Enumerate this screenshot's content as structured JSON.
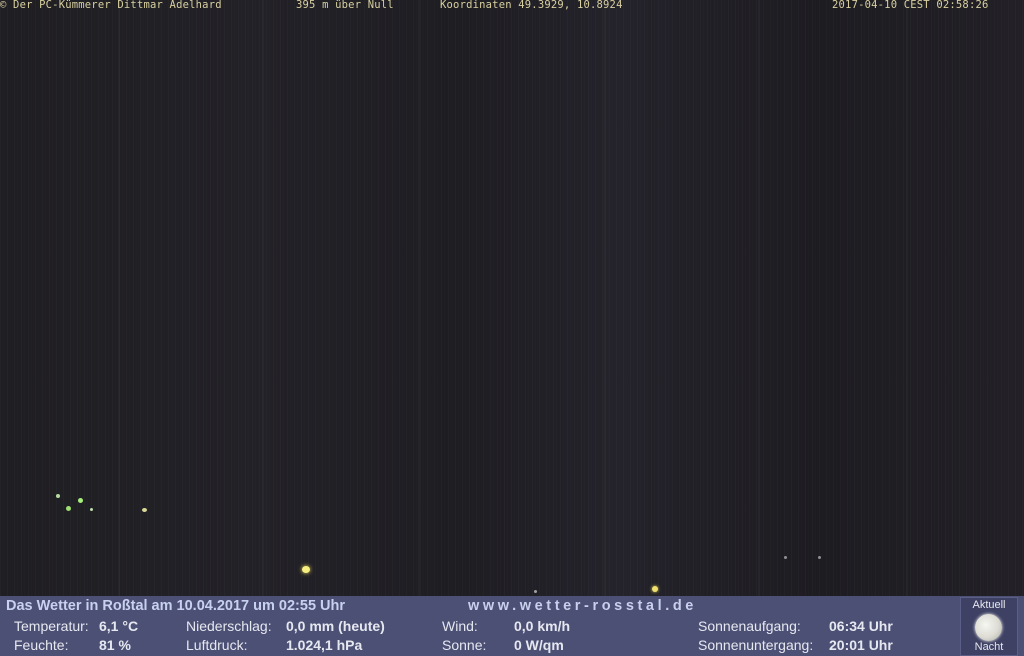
{
  "overlay": {
    "copyright": "© Der PC-Kümmerer Dittmar Adelhard",
    "altitude": "395 m über Null",
    "coordinates": "Koordinaten 49.3929, 10.8924",
    "timestamp": "2017-04-10 CEST 02:58:26"
  },
  "weather": {
    "title": "Das Wetter in Roßtal am 10.04.2017 um 02:55 Uhr",
    "site": "www.wetter-rosstal.de",
    "temperature": {
      "label": "Temperatur:",
      "value": "6,1 °C"
    },
    "humidity": {
      "label": "Feuchte:",
      "value": "81 %"
    },
    "precipitation": {
      "label": "Niederschlag:",
      "value": "0,0 mm (heute)"
    },
    "pressure": {
      "label": "Luftdruck:",
      "value": "1.024,1 hPa"
    },
    "wind": {
      "label": "Wind:",
      "value": "0,0 km/h"
    },
    "sun": {
      "label": "Sonne:",
      "value": "0 W/qm"
    },
    "sunrise": {
      "label": "Sonnenaufgang:",
      "value": "06:34 Uhr"
    },
    "sunset": {
      "label": "Sonnenuntergang:",
      "value": "20:01 Uhr"
    },
    "moon": {
      "top_label": "Aktuell",
      "bottom_label": "Nacht",
      "icon": "full-moon-icon"
    }
  },
  "colors": {
    "info_bar": "#4d5075",
    "overlay_text": "#d8d0a0",
    "night_sky": "#1f1e22"
  }
}
